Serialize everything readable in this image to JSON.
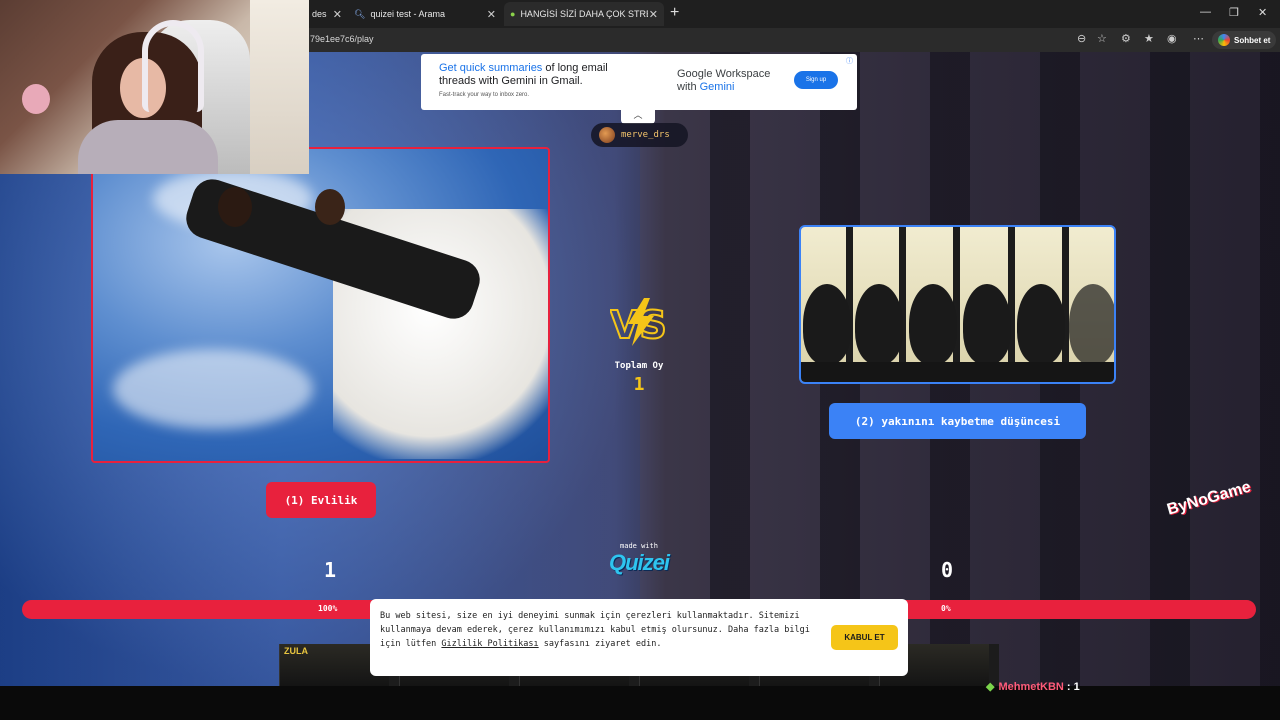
{
  "browser": {
    "tabs": [
      {
        "label": "des"
      },
      {
        "label": "quizei test - Arama"
      },
      {
        "label": "HANGİSİ SİZİ DAHA ÇOK STRESE S"
      }
    ],
    "url": "79e1ee7c6/play",
    "copilot_label": "Sohbet et"
  },
  "ad_top": {
    "headline_hl": "Get quick summaries",
    "headline_rest": " of long email threads with Gemini in Gmail.",
    "subtext": "Fast-track your way to inbox zero.",
    "brand_line1": "Google Workspace",
    "brand_line2_prefix": "with ",
    "brand_line2_gem": "Gemini",
    "signup": "Sign up"
  },
  "user": {
    "name": "merve_drs"
  },
  "options": {
    "left_label": "(1) Evlilik",
    "right_label": "(2) yakınını kaybetme düşüncesi",
    "left_score": "1",
    "right_score": "0",
    "left_percent": "100%",
    "right_percent": "0%",
    "left_fill": 1.0
  },
  "total": {
    "label": "Toplam Oy",
    "value": "1"
  },
  "brand": {
    "made_with": "made with",
    "logo": "Quizei"
  },
  "cookie": {
    "text_before_link": "Bu web sitesi, size en iyi deneyimi sunmak için çerezleri kullanmaktadır. Sitemizi kullanmaya devam ederek, çerez kullanımımızı kabul etmiş olursunuz. Daha fazla bilgi için lütfen ",
    "link": "Gizlilik Politikası",
    "text_after_link": " sayfasını ziyaret edin.",
    "accept": "KABUL ET"
  },
  "ad_bottom": {
    "logo": "ZULA"
  },
  "overlay": {
    "watermark": "ByNoGame"
  },
  "chat": {
    "user": "MehmetKBN",
    "count": " : 1"
  },
  "colors": {
    "red": "#e8213d",
    "blue": "#3b82f6",
    "yellow": "#f5c518"
  }
}
